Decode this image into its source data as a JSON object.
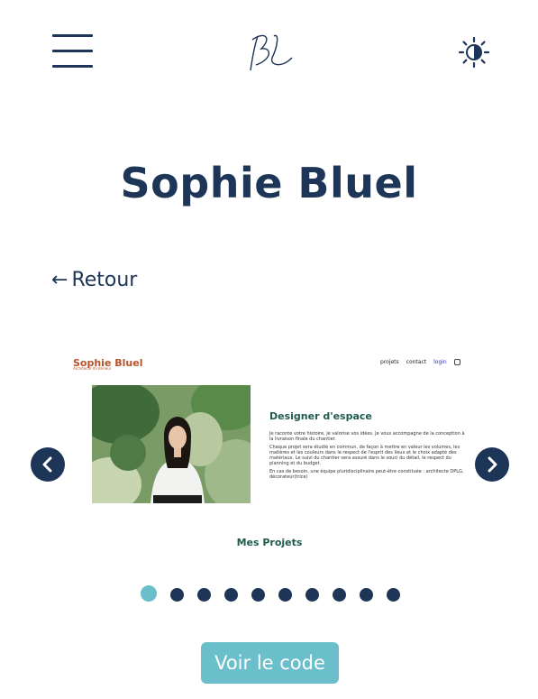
{
  "header": {
    "menu_icon": "hamburger-menu-icon",
    "logo_text": "BL",
    "theme_icon": "theme-toggle-sun-icon"
  },
  "hero": {
    "title": "Sophie Bluel"
  },
  "back": {
    "arrow": "←",
    "label": "Retour"
  },
  "carousel": {
    "prev_icon": "chevron-left-icon",
    "next_icon": "chevron-right-icon",
    "slide": {
      "brand": "Sophie Bluel",
      "brand_sub": "Architecte d'intérieur",
      "nav": [
        "projets",
        "contact",
        "login"
      ],
      "heading": "Designer d'espace",
      "paragraphs": [
        "Je raconte votre histoire, je valorise vos idées. Je vous accompagne de la conception à la livraison finale du chantier.",
        "Chaque projet sera étudié en commun, de façon à mettre en valeur les volumes, les matières et les couleurs dans le respect de l'esprit des lieux et le choix adapté des matériaux. Le suivi du chantier sera assuré dans le souci du détail, le respect du planning et du budget.",
        "En cas de besoin, une équipe pluridisciplinaire peut-être constituée : architecte DPLG, décorateur(trice)"
      ],
      "projects_label": "Mes Projets"
    },
    "dots_total": 10,
    "active_index": 0
  },
  "cta": {
    "label": "Voir le code"
  },
  "colors": {
    "primary": "#1d3557",
    "accent": "#6bbfca",
    "brand_orange": "#b5542a",
    "mini_green": "#1f5b4d"
  }
}
